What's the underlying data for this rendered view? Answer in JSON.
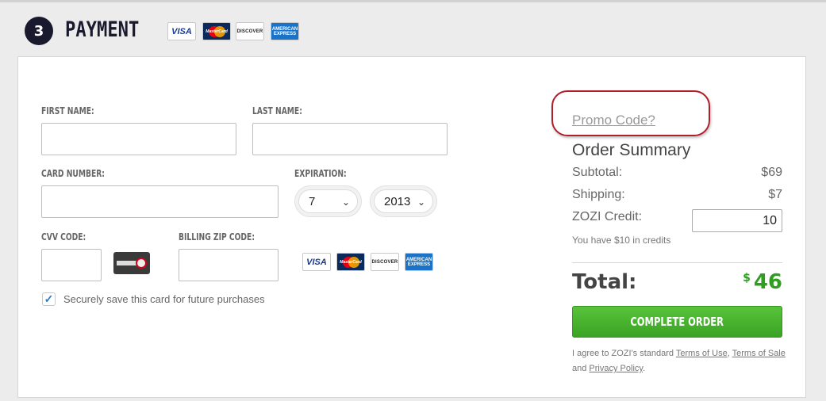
{
  "header": {
    "step_number": "3",
    "title": "PAYMENT"
  },
  "card_logos": {
    "visa": "VISA",
    "mastercard": "MasterCard",
    "discover": "DISCOVER",
    "amex_line1": "AMERICAN",
    "amex_line2": "EXPRESS"
  },
  "form": {
    "first_name_label": "FIRST NAME:",
    "first_name_value": "",
    "last_name_label": "LAST NAME:",
    "last_name_value": "",
    "card_number_label": "CARD NUMBER:",
    "card_number_value": "",
    "expiration_label": "EXPIRATION:",
    "exp_month": "7",
    "exp_year": "2013",
    "cvv_label": "CVV CODE:",
    "cvv_value": "",
    "zip_label": "BILLING ZIP CODE:",
    "zip_value": "",
    "save_card_checked": true,
    "save_card_label": "Securely save this card for future purchases"
  },
  "summary": {
    "promo_link": "Promo Code?",
    "title": "Order Summary",
    "subtotal_label": "Subtotal:",
    "subtotal_value": "$69",
    "shipping_label": "Shipping:",
    "shipping_value": "$7",
    "credit_label": "ZOZI Credit:",
    "credit_value": "10",
    "credit_note": "You have $10 in credits",
    "total_label": "Total:",
    "total_currency": "$",
    "total_value": "46",
    "complete_button": "COMPLETE ORDER",
    "terms_prefix": "I agree to ZOZI's standard",
    "terms_of_use": "Terms of Use",
    "terms_of_sale": "Terms of Sale",
    "terms_and": "and",
    "privacy_policy": "Privacy Policy"
  },
  "colors": {
    "accent_green": "#3aa324",
    "total_green": "#2e9e1f",
    "dark_navy": "#1a1a2e",
    "promo_highlight": "#b01e2a"
  }
}
